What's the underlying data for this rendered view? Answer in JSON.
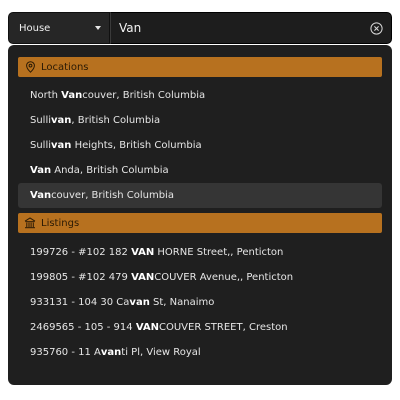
{
  "search": {
    "type_selected": "House",
    "query": "Van"
  },
  "sections": [
    {
      "title": "Locations",
      "icon": "location-pin-icon",
      "items": [
        {
          "parts": [
            {
              "text": "North ",
              "bold": false
            },
            {
              "text": "Van",
              "bold": true
            },
            {
              "text": "couver, British Columbia",
              "bold": false
            }
          ],
          "selected": false
        },
        {
          "parts": [
            {
              "text": "Sulli",
              "bold": false
            },
            {
              "text": "van",
              "bold": true
            },
            {
              "text": ", British Columbia",
              "bold": false
            }
          ],
          "selected": false
        },
        {
          "parts": [
            {
              "text": "Sulli",
              "bold": false
            },
            {
              "text": "van",
              "bold": true
            },
            {
              "text": " Heights, British Columbia",
              "bold": false
            }
          ],
          "selected": false
        },
        {
          "parts": [
            {
              "text": "Van",
              "bold": true
            },
            {
              "text": " Anda, British Columbia",
              "bold": false
            }
          ],
          "selected": false
        },
        {
          "parts": [
            {
              "text": "Van",
              "bold": true
            },
            {
              "text": "couver, British Columbia",
              "bold": false
            }
          ],
          "selected": true
        }
      ]
    },
    {
      "title": "Listings",
      "icon": "building-icon",
      "items": [
        {
          "parts": [
            {
              "text": "199726 - #102 182 ",
              "bold": false
            },
            {
              "text": "VAN",
              "bold": true
            },
            {
              "text": " HORNE Street,, Penticton",
              "bold": false
            }
          ],
          "selected": false
        },
        {
          "parts": [
            {
              "text": "199805 - #102 479 ",
              "bold": false
            },
            {
              "text": "VAN",
              "bold": true
            },
            {
              "text": "COUVER Avenue,, Penticton",
              "bold": false
            }
          ],
          "selected": false
        },
        {
          "parts": [
            {
              "text": "933131 - 104 30 Ca",
              "bold": false
            },
            {
              "text": "van",
              "bold": true
            },
            {
              "text": " St, Nanaimo",
              "bold": false
            }
          ],
          "selected": false
        },
        {
          "parts": [
            {
              "text": "2469565 - 105 - 914 ",
              "bold": false
            },
            {
              "text": "VAN",
              "bold": true
            },
            {
              "text": "COUVER STREET, Creston",
              "bold": false
            }
          ],
          "selected": false
        },
        {
          "parts": [
            {
              "text": "935760 - 11 A",
              "bold": false
            },
            {
              "text": "van",
              "bold": true
            },
            {
              "text": "ti Pl, View Royal",
              "bold": false
            }
          ],
          "selected": false
        }
      ]
    }
  ],
  "colors": {
    "section_header_bg": "#b7711f",
    "panel_bg": "#1f1f1f",
    "selected_row_bg": "#353535"
  }
}
